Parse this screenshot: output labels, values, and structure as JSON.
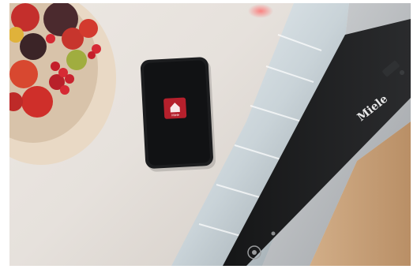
{
  "scene": {
    "brand_name": "Miele",
    "app_icon_label": "Miele",
    "colors": {
      "countertop": "#e9e4df",
      "bowl": "#e7d6c2",
      "phone_body": "#1c1d1f",
      "app_icon": "#b5202c",
      "control_panel": "#1b1c1e",
      "interior_glow": "#f2f6f8",
      "wood_floor": "#c7a27c",
      "steel": "#b9bcbf"
    },
    "icons": [
      "fruit-bowl",
      "smartphone",
      "miele-app-icon",
      "dishwasher-control-panel",
      "power-button-icon"
    ]
  }
}
